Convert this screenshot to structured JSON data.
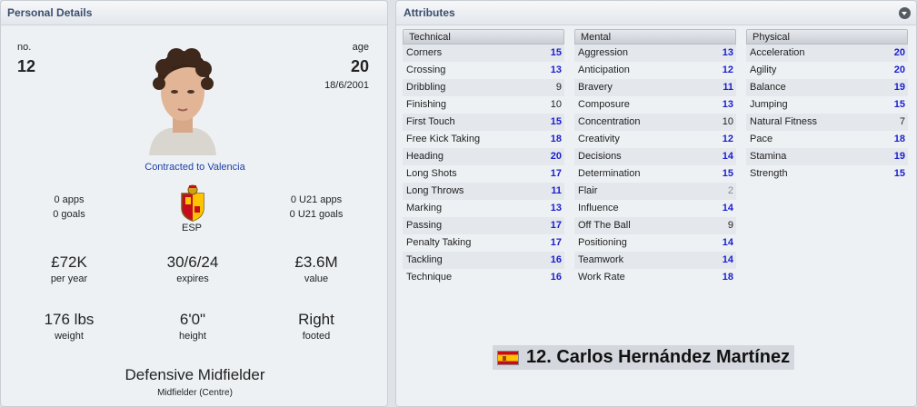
{
  "personal": {
    "header": "Personal Details",
    "no_label": "no.",
    "no_value": "12",
    "age_label": "age",
    "age_value": "20",
    "dob": "18/6/2001",
    "contract": "Contracted to Valencia",
    "apps": "0 apps",
    "goals": "0 goals",
    "nation_code": "ESP",
    "u21_apps": "0 U21 apps",
    "u21_goals": "0 U21 goals",
    "wage": "£72K",
    "wage_label": "per year",
    "expires": "30/6/24",
    "expires_label": "expires",
    "value": "£3.6M",
    "value_label": "value",
    "weight": "176 lbs",
    "weight_label": "weight",
    "height": "6'0\"",
    "height_label": "height",
    "foot": "Right",
    "foot_label": "footed",
    "position": "Defensive Midfielder",
    "position_detail": "Midfielder (Centre)"
  },
  "attributes": {
    "header": "Attributes",
    "technical": {
      "title": "Technical",
      "rows": [
        {
          "name": "Corners",
          "value": "15"
        },
        {
          "name": "Crossing",
          "value": "13"
        },
        {
          "name": "Dribbling",
          "value": "9"
        },
        {
          "name": "Finishing",
          "value": "10"
        },
        {
          "name": "First Touch",
          "value": "15"
        },
        {
          "name": "Free Kick Taking",
          "value": "18"
        },
        {
          "name": "Heading",
          "value": "20"
        },
        {
          "name": "Long Shots",
          "value": "17"
        },
        {
          "name": "Long Throws",
          "value": "11"
        },
        {
          "name": "Marking",
          "value": "13"
        },
        {
          "name": "Passing",
          "value": "17"
        },
        {
          "name": "Penalty Taking",
          "value": "17"
        },
        {
          "name": "Tackling",
          "value": "16"
        },
        {
          "name": "Technique",
          "value": "16"
        }
      ]
    },
    "mental": {
      "title": "Mental",
      "rows": [
        {
          "name": "Aggression",
          "value": "13"
        },
        {
          "name": "Anticipation",
          "value": "12"
        },
        {
          "name": "Bravery",
          "value": "11"
        },
        {
          "name": "Composure",
          "value": "13"
        },
        {
          "name": "Concentration",
          "value": "10"
        },
        {
          "name": "Creativity",
          "value": "12"
        },
        {
          "name": "Decisions",
          "value": "14"
        },
        {
          "name": "Determination",
          "value": "15"
        },
        {
          "name": "Flair",
          "value": "2"
        },
        {
          "name": "Influence",
          "value": "14"
        },
        {
          "name": "Off The Ball",
          "value": "9"
        },
        {
          "name": "Positioning",
          "value": "14"
        },
        {
          "name": "Teamwork",
          "value": "14"
        },
        {
          "name": "Work Rate",
          "value": "18"
        }
      ]
    },
    "physical": {
      "title": "Physical",
      "rows": [
        {
          "name": "Acceleration",
          "value": "20"
        },
        {
          "name": "Agility",
          "value": "20"
        },
        {
          "name": "Balance",
          "value": "19"
        },
        {
          "name": "Jumping",
          "value": "15"
        },
        {
          "name": "Natural Fitness",
          "value": "7"
        },
        {
          "name": "Pace",
          "value": "18"
        },
        {
          "name": "Stamina",
          "value": "19"
        },
        {
          "name": "Strength",
          "value": "15"
        }
      ]
    }
  },
  "player_name": "12. Carlos Hernández Martínez",
  "icons": {
    "flag": "spain-flag-icon",
    "menu": "dropdown-menu-icon",
    "badge": "spain-federation-badge"
  }
}
